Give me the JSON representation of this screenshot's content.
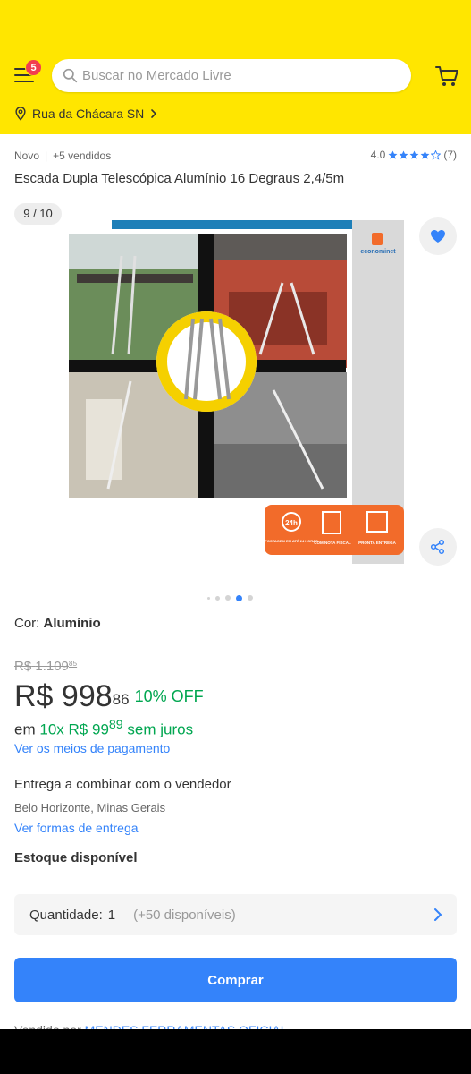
{
  "colors": {
    "header_bg": "#ffe600",
    "accent_blue": "#3483fa",
    "price_green": "#00a650",
    "badge_red": "#f23d4f"
  },
  "header": {
    "menu_icon": "hamburger-menu-icon",
    "notification_count": "5",
    "search_placeholder": "Buscar no Mercado Livre",
    "cart_icon": "cart-icon",
    "location": "Rua da Chácara SN"
  },
  "product": {
    "condition": "Novo",
    "separator": "|",
    "sold": "+5 vendidos",
    "rating_value": "4.0",
    "rating_stars": 4,
    "rating_count": "(7)",
    "title": "Escada Dupla Telescópica Alumínio 16 Degraus 2,4/5m"
  },
  "gallery": {
    "counter": "9 / 10",
    "image_label": "econominet",
    "badges": [
      "24h",
      "POSTAGEM EM ATÉ 24 HORAS",
      "COM NOTA FISCAL",
      "PRONTA ENTREGA"
    ],
    "dot_count": 5,
    "active_dot": 3
  },
  "variant": {
    "label": "Cor:",
    "value": "Alumínio"
  },
  "pricing": {
    "currency": "R$",
    "old_price_int": "1.109",
    "old_price_cents": "85",
    "price_int": "998",
    "price_cents": "86",
    "discount": "10% OFF",
    "installments_prefix": "em",
    "installments_count": "10x",
    "installment_int": "99",
    "installment_cents": "89",
    "installments_suffix": "sem juros",
    "payment_link": "Ver os meios de pagamento"
  },
  "delivery": {
    "title": "Entrega a combinar com o vendedor",
    "city": "Belo Horizonte, Minas Gerais",
    "link": "Ver formas de entrega"
  },
  "stock": {
    "label": "Estoque disponível",
    "quantity_label": "Quantidade:",
    "quantity_value": "1",
    "available": "(+50 disponíveis)"
  },
  "actions": {
    "buy": "Comprar"
  },
  "seller": {
    "prefix": "Vendido por",
    "name": "MENDES FERRAMENTAS OFICIAL"
  }
}
